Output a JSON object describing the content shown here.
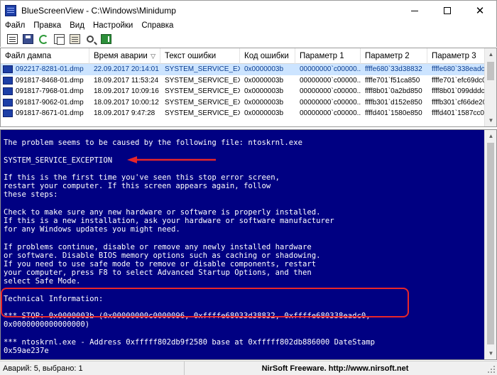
{
  "window": {
    "title": "BlueScreenView - C:\\Windows\\Minidump",
    "minimize": "",
    "maximize": "",
    "close": "✕"
  },
  "menu": {
    "items": [
      "Файл",
      "Правка",
      "Вид",
      "Настройки",
      "Справка"
    ]
  },
  "toolbar": {
    "icons": [
      "select-columns-icon",
      "save-icon",
      "refresh-icon",
      "copy-icon",
      "properties-icon",
      "find-icon",
      "exit-icon"
    ]
  },
  "grid": {
    "columns": [
      {
        "label": "Файл дампа"
      },
      {
        "label": "Время аварии"
      },
      {
        "label": "Текст ошибки"
      },
      {
        "label": "Код ошибки"
      },
      {
        "label": "Параметр 1"
      },
      {
        "label": "Параметр 2"
      },
      {
        "label": "Параметр 3"
      }
    ],
    "sorted_column_indicator": "▽",
    "rows": [
      {
        "file": "092217-8281-01.dmp",
        "time": "22.09.2017 20:14:01",
        "text": "SYSTEM_SERVICE_EX...",
        "code": "0x0000003b",
        "p1": "00000000`c00000...",
        "p2": "ffffe680`33d38832",
        "p3": "ffffe680`338eadc0",
        "selected": true
      },
      {
        "file": "091817-8468-01.dmp",
        "time": "18.09.2017 11:53:24",
        "text": "SYSTEM_SERVICE_EX...",
        "code": "0x0000003b",
        "p1": "00000000`c00000...",
        "p2": "ffffe701`f51ca850",
        "p3": "ffffe701`efc69dc0",
        "selected": false
      },
      {
        "file": "091817-7968-01.dmp",
        "time": "18.09.2017 10:09:16",
        "text": "SYSTEM_SERVICE_EX...",
        "code": "0x0000003b",
        "p1": "00000000`c00000...",
        "p2": "ffff8b01`0a2bd850",
        "p3": "ffff8b01`099dddc",
        "selected": false
      },
      {
        "file": "091817-9062-01.dmp",
        "time": "18.09.2017 10:00:12",
        "text": "SYSTEM_SERVICE_EX...",
        "code": "0x0000003b",
        "p1": "00000000`c00000...",
        "p2": "ffffb301`d152e850",
        "p3": "ffffb301`cf66de20",
        "selected": false
      },
      {
        "file": "091817-8671-01.dmp",
        "time": "18.09.2017 9:47:28",
        "text": "SYSTEM_SERVICE_EX...",
        "code": "0x0000003b",
        "p1": "00000000`c00000...",
        "p2": "ffffd401`1580e850",
        "p3": "ffffd401`1587cc0",
        "selected": false
      }
    ]
  },
  "bsod": {
    "lines": [
      "",
      "The problem seems to be caused by the following file: ntoskrnl.exe",
      "",
      "SYSTEM_SERVICE_EXCEPTION",
      "",
      "If this is the first time you've seen this stop error screen,",
      "restart your computer. If this screen appears again, follow",
      "these steps:",
      "",
      "Check to make sure any new hardware or software is properly installed.",
      "If this is a new installation, ask your hardware or software manufacturer",
      "for any Windows updates you might need.",
      "",
      "If problems continue, disable or remove any newly installed hardware",
      "or software. Disable BIOS memory options such as caching or shadowing.",
      "If you need to use safe mode to remove or disable components, restart",
      "your computer, press F8 to select Advanced Startup Options, and then",
      "select Safe Mode.",
      "",
      "Technical Information:",
      "",
      "*** STOP: 0x0000003b (0x00000000c0000096, 0xffffe68033d38832, 0xffffe680338eadc0,",
      "0x0000000000000000)",
      "",
      "*** ntoskrnl.exe - Address 0xfffff802db9f2580 base at 0xfffff802db886000 DateStamp",
      "0x59ae237e"
    ]
  },
  "status": {
    "count": "Аварий: 5, выбрано: 1",
    "credit": "NirSoft Freeware.  http://www.nirsoft.net"
  },
  "colors": {
    "bsod_background": "#000082",
    "annotation_red": "#e8262a",
    "selection": "#cce4ff"
  }
}
